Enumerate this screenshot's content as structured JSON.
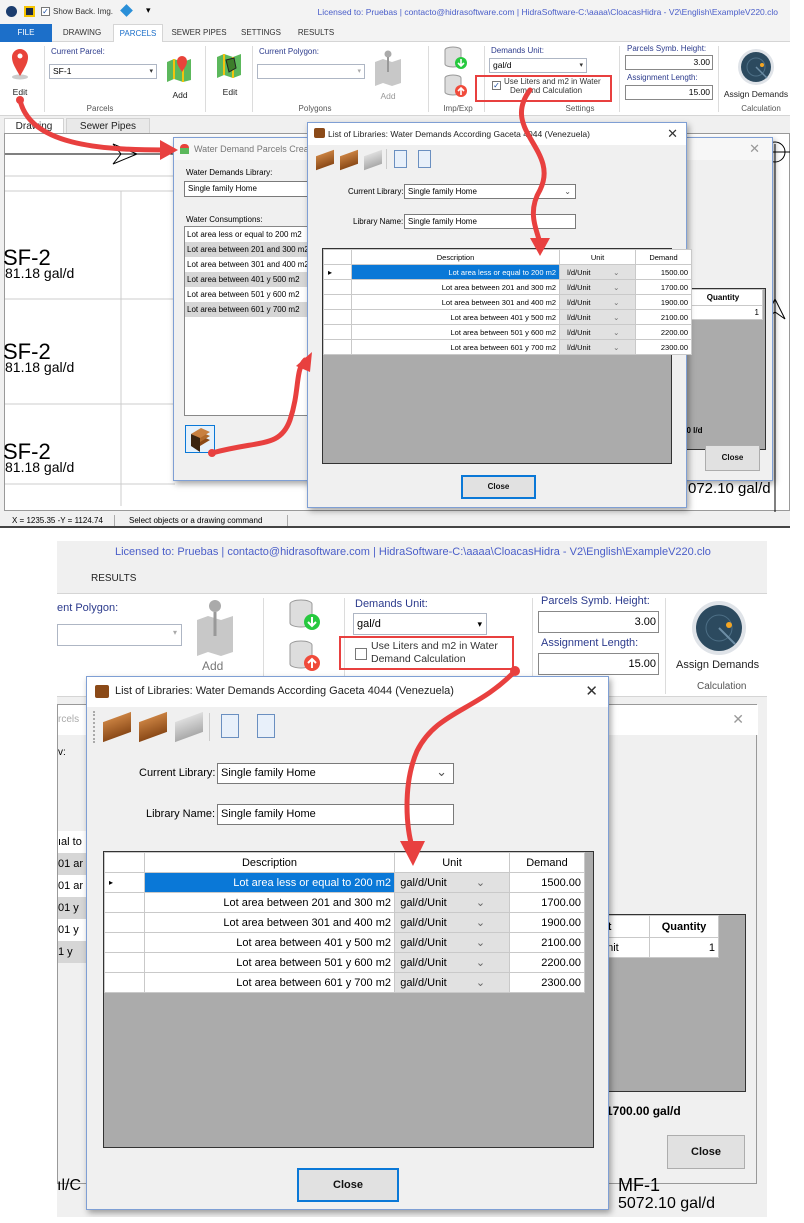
{
  "top": {
    "qat": {
      "show_back_img_label": "Show Back. Img.",
      "show_back_img_checked": true
    },
    "license_text": "Licensed to: Pruebas | contacto@hidrasoftware.com | HidraSoftware-C:\\aaaa\\CloacasHidra - V2\\English\\ExampleV220.clo",
    "tabs": [
      "FILE",
      "DRAWING",
      "PARCELS",
      "SEWER PIPES",
      "SETTINGS",
      "RESULTS"
    ],
    "active_tab": "PARCELS",
    "ribbon": {
      "edit_parcel_label": "Edit",
      "current_parcel_label": "Current Parcel:",
      "current_parcel_value": "SF-1",
      "add_parcel_label": "Add",
      "parcels_group": "Parcels",
      "edit_polygon_label": "Edit",
      "current_polygon_label": "Current Polygon:",
      "current_polygon_value": "",
      "add_polygon_label": "Add",
      "polygons_group": "Polygons",
      "impexp_group": "Imp/Exp",
      "demands_unit_label": "Demands Unit:",
      "demands_unit_value": "gal/d",
      "use_liters_label_1": "Use Liters and m2 in Water",
      "use_liters_label_2": "Demand Calculation",
      "use_liters_checked": true,
      "settings_group": "Settings",
      "symb_height_label": "Parcels Symb. Height:",
      "symb_height_value": "3.00",
      "assign_length_label": "Assignment Length:",
      "assign_length_value": "15.00",
      "assign_demands_label": "Assign Demands",
      "calculation_group": "Calculation"
    },
    "doc_tabs": [
      "Drawing",
      "Sewer Pipes"
    ],
    "canvas": {
      "labels": [
        {
          "name": "SF-2",
          "value": "81.18 gal/d"
        },
        {
          "name": "SF-2",
          "value": "81.18 gal/d"
        },
        {
          "name": "SF-2",
          "value": "81.18 gal/d"
        }
      ],
      "right_label": "072.10 gal/d"
    },
    "status": {
      "coords": "X = 1235.35 -Y = 1124.74",
      "message": "Select objects or a drawing command"
    },
    "creator": {
      "title": "Water Demand Parcels Creator",
      "library_label": "Water Demands Library:",
      "library_value": "Single family Home",
      "consumptions_label": "Water Consumptions:",
      "consumptions": [
        "Lot area less or equal to 200 m2",
        "Lot area between 201 and 300 m2",
        "Lot area between 301 and 400 m2",
        "Lot area between 401 y 500 m2",
        "Lot area between 501 y 600 m2",
        "Lot area between 601 y 700 m2"
      ],
      "quantity_header": "Quantity",
      "quantity_value": "1",
      "total": "00 l/d",
      "close": "Close"
    },
    "library": {
      "title": "List of Libraries: Water Demands According Gaceta 4044 (Venezuela)",
      "current_library_label": "Current Library:",
      "current_library_value": "Single family Home",
      "library_name_label": "Library Name:",
      "library_name_value": "Single family Home",
      "columns": [
        "Description",
        "Unit",
        "Demand"
      ],
      "rows": [
        {
          "desc": "Lot area less or equal to 200 m2",
          "unit": "l/d/Unit",
          "demand": "1500.00"
        },
        {
          "desc": "Lot area between 201 and 300 m2",
          "unit": "l/d/Unit",
          "demand": "1700.00"
        },
        {
          "desc": "Lot area between 301 and 400 m2",
          "unit": "l/d/Unit",
          "demand": "1900.00"
        },
        {
          "desc": "Lot area between 401 y 500 m2",
          "unit": "l/d/Unit",
          "demand": "2100.00"
        },
        {
          "desc": "Lot area between 501 y 600 m2",
          "unit": "l/d/Unit",
          "demand": "2200.00"
        },
        {
          "desc": "Lot area between 601 y 700 m2",
          "unit": "l/d/Unit",
          "demand": "2300.00"
        }
      ],
      "close": "Close"
    }
  },
  "bottom": {
    "license_text": "Licensed to: Pruebas | contacto@hidrasoftware.com | HidraSoftware-C:\\aaaa\\CloacasHidra - V2\\English\\ExampleV220.clo",
    "tab_results": "RESULTS",
    "ribbon": {
      "current_polygon_label": "ent Polygon:",
      "add_polygon_label": "Add",
      "demands_unit_label": "Demands Unit:",
      "demands_unit_value": "gal/d",
      "use_liters_label_1": "Use Liters and m2 in Water",
      "use_liters_label_2": "Demand Calculation",
      "use_liters_checked": false,
      "symb_height_label": "Parcels Symb. Height:",
      "symb_height_value": "3.00",
      "assign_length_label": "Assignment Length:",
      "assign_length_value": "15.00",
      "assign_demands_label": "Assign Demands",
      "calculation_group": "Calculation"
    },
    "behind": {
      "parcels_fragment": "rcels",
      "library_fragment": "v:",
      "consumption_fragments": [
        "ıal to",
        "01 ar",
        "01 ar",
        "01 y",
        "01 y",
        "1 y"
      ],
      "unit_header": "Unit",
      "quantity_header": "Quantity",
      "unit_value": "d/Unit",
      "quantity_value": "1",
      "total": "1700.00 gal/d",
      "close": "Close",
      "canvas_fragment_left": "ıl/C",
      "canvas_fragment_right_1": "MF-1",
      "canvas_fragment_right_2": "5072.10 gal/d"
    },
    "library": {
      "title": "List of Libraries: Water Demands According Gaceta 4044 (Venezuela)",
      "current_library_label": "Current Library:",
      "current_library_value": "Single family Home",
      "library_name_label": "Library Name:",
      "library_name_value": "Single family Home",
      "columns": [
        "Description",
        "Unit",
        "Demand"
      ],
      "rows": [
        {
          "desc": "Lot area less or equal to 200 m2",
          "unit": "gal/d/Unit",
          "demand": "1500.00"
        },
        {
          "desc": "Lot area between 201 and 300 m2",
          "unit": "gal/d/Unit",
          "demand": "1700.00"
        },
        {
          "desc": "Lot area between 301 and 400 m2",
          "unit": "gal/d/Unit",
          "demand": "1900.00"
        },
        {
          "desc": "Lot area between 401 y 500 m2",
          "unit": "gal/d/Unit",
          "demand": "2100.00"
        },
        {
          "desc": "Lot area between 501 y 600 m2",
          "unit": "gal/d/Unit",
          "demand": "2200.00"
        },
        {
          "desc": "Lot area between 601 y 700 m2",
          "unit": "gal/d/Unit",
          "demand": "2300.00"
        }
      ],
      "close": "Close"
    }
  },
  "colors": {
    "accent": "#1c6fc9",
    "selection": "#0a78d7",
    "annotation_red": "#e8403f",
    "license_text": "#4a5ec9"
  }
}
